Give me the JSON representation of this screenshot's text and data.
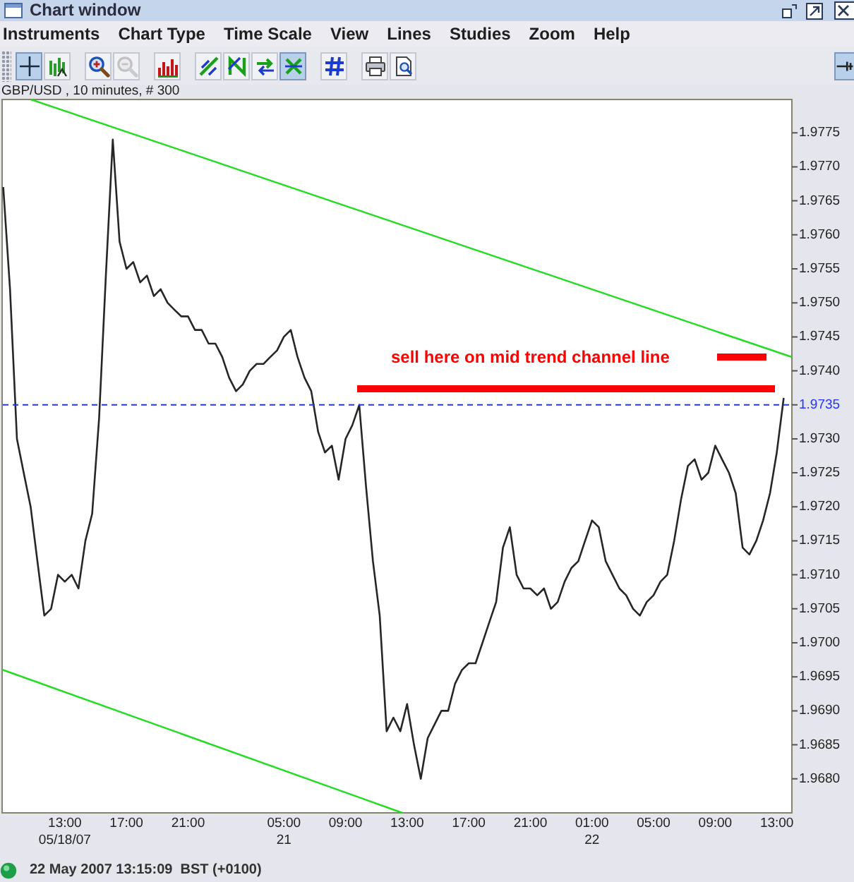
{
  "window": {
    "title": "Chart window"
  },
  "menu": [
    "Instruments",
    "Chart Type",
    "Time Scale",
    "View",
    "Lines",
    "Studies",
    "Zoom",
    "Help"
  ],
  "toolbar": {
    "groups": [
      [
        {
          "kind": "crosshair",
          "selected": true,
          "disabled": false
        },
        {
          "kind": "candles",
          "selected": false,
          "disabled": false
        }
      ],
      [
        {
          "kind": "zoomin",
          "selected": false,
          "disabled": false
        },
        {
          "kind": "zoomout",
          "selected": false,
          "disabled": true
        }
      ],
      [
        {
          "kind": "bars",
          "selected": false,
          "disabled": false
        }
      ],
      [
        {
          "kind": "trend",
          "selected": false,
          "disabled": false
        },
        {
          "kind": "zigzag",
          "selected": false,
          "disabled": false
        },
        {
          "kind": "swap",
          "selected": false,
          "disabled": false
        },
        {
          "kind": "cross",
          "selected": true,
          "disabled": false
        }
      ],
      [
        {
          "kind": "grid",
          "selected": false,
          "disabled": false
        }
      ],
      [
        {
          "kind": "print",
          "selected": false,
          "disabled": false
        },
        {
          "kind": "preview",
          "selected": false,
          "disabled": false
        }
      ]
    ],
    "trailing": [
      {
        "kind": "pin",
        "selected": true,
        "disabled": false
      }
    ]
  },
  "chart": {
    "chart_data": {
      "type": "line",
      "title": "GBP/USD , 10 minutes, # 300",
      "ylim": [
        1.9675,
        1.978
      ],
      "categories": [
        null,
        null,
        null,
        null,
        null,
        null,
        null,
        null,
        null,
        "13:00\n05/18/07",
        null,
        null,
        null,
        null,
        null,
        null,
        null,
        null,
        "17:00",
        null,
        null,
        null,
        null,
        null,
        null,
        null,
        null,
        "21:00",
        null,
        null,
        null,
        null,
        null,
        null,
        null,
        null,
        null,
        null,
        null,
        null,
        null,
        "05:00\n21",
        null,
        null,
        null,
        null,
        null,
        null,
        null,
        null,
        "09:00",
        null,
        null,
        null,
        null,
        null,
        null,
        null,
        null,
        "13:00",
        null,
        null,
        null,
        null,
        null,
        null,
        null,
        null,
        "17:00",
        null,
        null,
        null,
        null,
        null,
        null,
        null,
        null,
        "21:00",
        null,
        null,
        null,
        null,
        null,
        null,
        null,
        null,
        "01:00\n22",
        null,
        null,
        null,
        null,
        null,
        null,
        null,
        null,
        "05:00",
        null,
        null,
        null,
        null,
        null,
        null,
        null,
        null,
        "09:00",
        null,
        null,
        null,
        null,
        null,
        null,
        null,
        null,
        "13:00",
        null
      ],
      "values": [
        1.9767,
        1.9752,
        1.973,
        1.9725,
        1.972,
        1.9712,
        1.9704,
        1.9705,
        1.971,
        1.9709,
        1.971,
        1.9708,
        1.9715,
        1.9719,
        1.9733,
        1.9754,
        1.9774,
        1.9759,
        1.9755,
        1.9756,
        1.9753,
        1.9754,
        1.9751,
        1.9752,
        1.975,
        1.9749,
        1.9748,
        1.9748,
        1.9746,
        1.9746,
        1.9744,
        1.9744,
        1.9742,
        1.9739,
        1.9737,
        1.9738,
        1.974,
        1.9741,
        1.9741,
        1.9742,
        1.9743,
        1.9745,
        1.9746,
        1.9742,
        1.9739,
        1.9737,
        1.9731,
        1.9728,
        1.9729,
        1.9724,
        1.973,
        1.9732,
        1.9735,
        1.9723,
        1.9712,
        1.9704,
        1.9687,
        1.9689,
        1.9687,
        1.9691,
        1.9685,
        1.968,
        1.9686,
        1.9688,
        1.969,
        1.969,
        1.9694,
        1.9696,
        1.9697,
        1.9697,
        1.97,
        1.9703,
        1.9706,
        1.9714,
        1.9717,
        1.971,
        1.9708,
        1.9708,
        1.9707,
        1.9708,
        1.9705,
        1.9706,
        1.9709,
        1.9711,
        1.9712,
        1.9715,
        1.9718,
        1.9717,
        1.9712,
        1.971,
        1.9708,
        1.9707,
        1.9705,
        1.9704,
        1.9706,
        1.9707,
        1.9709,
        1.971,
        1.9715,
        1.9721,
        1.9726,
        1.9727,
        1.9724,
        1.9725,
        1.9729,
        1.9727,
        1.9725,
        1.9722,
        1.9714,
        1.9713,
        1.9715,
        1.9718,
        1.9722,
        1.9728,
        1.9736
      ],
      "yticks": [
        {
          "value": 1.968,
          "label": "1.9680"
        },
        {
          "value": 1.9685,
          "label": "1.9685"
        },
        {
          "value": 1.969,
          "label": "1.9690"
        },
        {
          "value": 1.9695,
          "label": "1.9695"
        },
        {
          "value": 1.97,
          "label": "1.9700"
        },
        {
          "value": 1.9705,
          "label": "1.9705"
        },
        {
          "value": 1.971,
          "label": "1.9710"
        },
        {
          "value": 1.9715,
          "label": "1.9715"
        },
        {
          "value": 1.972,
          "label": "1.9720"
        },
        {
          "value": 1.9725,
          "label": "1.9725"
        },
        {
          "value": 1.973,
          "label": "1.9730"
        },
        {
          "value": 1.9735,
          "label": "1.9735"
        },
        {
          "value": 1.974,
          "label": "1.9740"
        },
        {
          "value": 1.9745,
          "label": "1.9745"
        },
        {
          "value": 1.975,
          "label": "1.9750"
        },
        {
          "value": 1.9755,
          "label": "1.9755"
        },
        {
          "value": 1.976,
          "label": "1.9760"
        },
        {
          "value": 1.9765,
          "label": "1.9765"
        },
        {
          "value": 1.977,
          "label": "1.9770"
        },
        {
          "value": 1.9775,
          "label": "1.9775"
        }
      ],
      "ref_lines": [
        {
          "axis": "y",
          "value": 1.9735,
          "color": "#2233ff"
        }
      ],
      "annotations": [
        "sell here on mid trend channel line"
      ]
    },
    "drawings": [
      {
        "kind": "trendline",
        "color": "#22dd22"
      },
      {
        "kind": "trendline",
        "color": "#22dd22"
      },
      {
        "kind": "marker",
        "color": "#ff0000"
      },
      {
        "kind": "marker",
        "color": "#ff0000"
      }
    ]
  },
  "status_bar": {
    "connected": true,
    "text": "22 May 2007 13:15:09  BST (+0100)"
  }
}
